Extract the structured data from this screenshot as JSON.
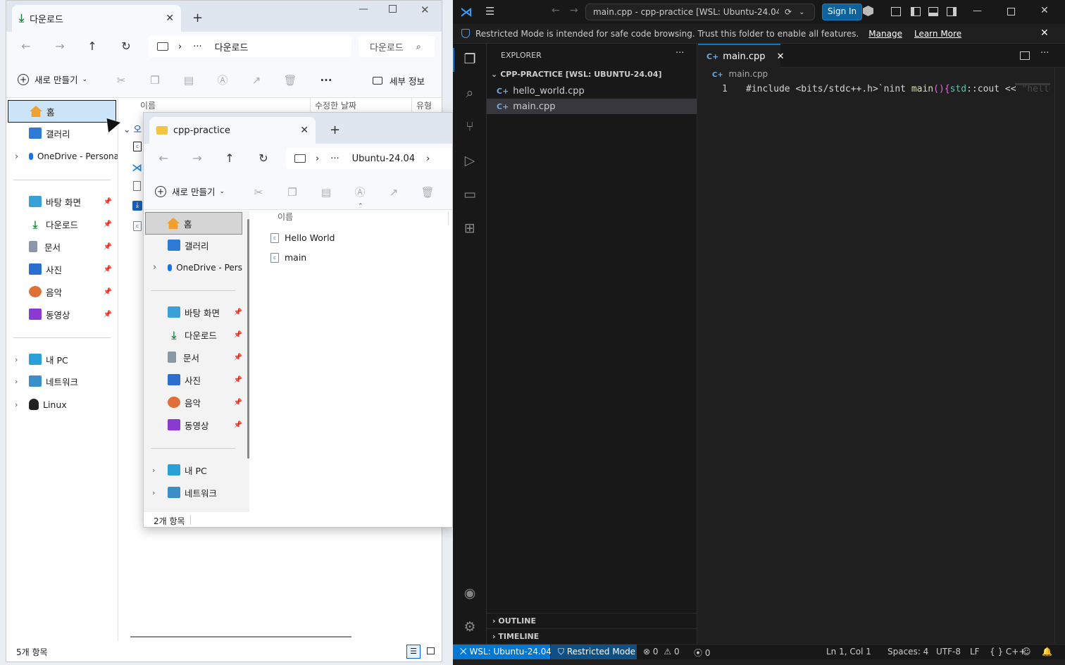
{
  "back_window": {
    "tab_title": "다운로드",
    "address_crumb": "다운로드",
    "search_placeholder": "다운로드",
    "new_button": "새로 만들기",
    "details_button": "세부 정보",
    "columns": {
      "name": "이름",
      "modified": "수정한 날짜",
      "type": "유형"
    },
    "sidebar": {
      "home": "홈",
      "gallery": "갤러리",
      "onedrive": "OneDrive - Persona",
      "desktop": "바탕 화면",
      "downloads": "다운로드",
      "documents": "문서",
      "pictures": "사진",
      "music": "음악",
      "videos": "동영상",
      "thispc": "내 PC",
      "network": "네트워크",
      "linux": "Linux"
    },
    "group_label": "오",
    "status": "5개 항목"
  },
  "front_window": {
    "tab_title": "cpp-practice",
    "address_crumb": "Ubuntu-24.04",
    "new_button": "새로 만들기",
    "column_name": "이름",
    "sidebar": {
      "home": "홈",
      "gallery": "갤러리",
      "onedrive": "OneDrive - Pers",
      "desktop": "바탕 화면",
      "downloads": "다운로드",
      "documents": "문서",
      "pictures": "사진",
      "music": "음악",
      "videos": "동영상",
      "thispc": "내 PC",
      "network": "네트워크"
    },
    "files": [
      "Hello World",
      "main"
    ],
    "status": "2개 항목"
  },
  "vscode": {
    "command_center": "main.cpp - cpp-practice [WSL: Ubuntu-24.04] ...",
    "sign_in": "Sign In",
    "banner": {
      "text": "Restricted Mode is intended for safe code browsing. Trust this folder to enable all features.",
      "manage": "Manage",
      "learn_more": "Learn More"
    },
    "explorer_title": "EXPLORER",
    "folder_title": "CPP-PRACTICE [WSL: UBUNTU-24.04]",
    "files": [
      "hello_world.cpp",
      "main.cpp"
    ],
    "outline": "OUTLINE",
    "timeline": "TIMELINE",
    "tab": "main.cpp",
    "breadcrumb": "main.cpp",
    "line_number": "1",
    "code": {
      "include": "#include <bits/stdc++.h>`nint ",
      "main": "main",
      "paren": "(){",
      "std": "std",
      "rest": "::cout << ",
      "str": "\"hello"
    },
    "status": {
      "remote": "WSL: Ubuntu-24.04",
      "restricted": "Restricted Mode",
      "errors": "0",
      "warnings": "0",
      "ports": "0",
      "position": "Ln 1, Col 1",
      "spaces": "Spaces: 4",
      "encoding": "UTF-8",
      "eol": "LF",
      "language": "C++"
    },
    "colors": {
      "accent": "#0078d4",
      "status_remote": "#16825d"
    }
  }
}
